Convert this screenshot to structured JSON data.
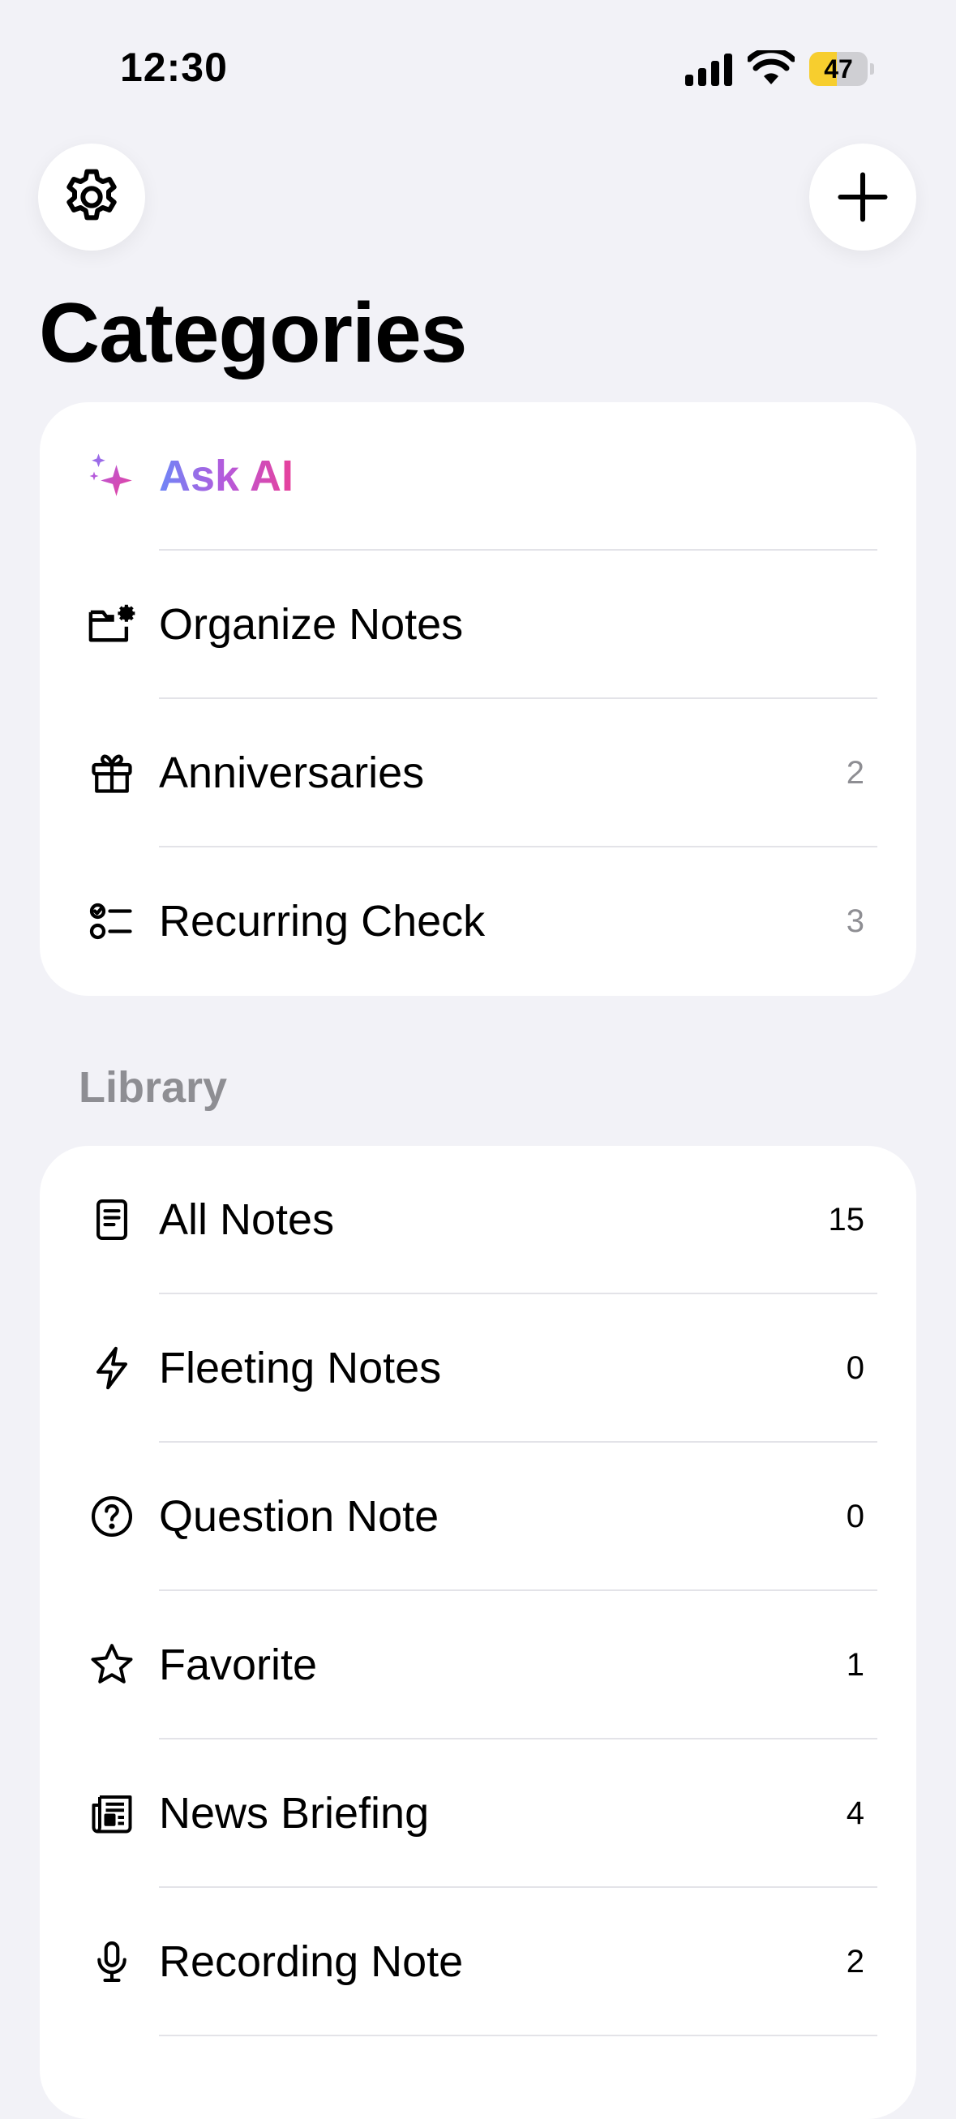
{
  "status_bar": {
    "time": "12:30",
    "battery_percent": "47",
    "battery_level": 0.47,
    "battery_color": "#F7CE2E"
  },
  "header": {
    "settings_icon": "gear-icon",
    "add_icon": "plus-icon",
    "title": "Categories"
  },
  "top_list": {
    "items": [
      {
        "label": "Ask AI",
        "icon": "sparkles-icon",
        "count": ""
      },
      {
        "label": "Organize Notes",
        "icon": "folder-gear-icon",
        "count": ""
      },
      {
        "label": "Anniversaries",
        "icon": "gift-icon",
        "count": "2"
      },
      {
        "label": "Recurring Check",
        "icon": "checklist-icon",
        "count": "3"
      }
    ]
  },
  "library": {
    "header": "Library",
    "items": [
      {
        "label": "All Notes",
        "icon": "document-icon",
        "count": "15"
      },
      {
        "label": "Fleeting Notes",
        "icon": "bolt-icon",
        "count": "0"
      },
      {
        "label": "Question Note",
        "icon": "question-circle-icon",
        "count": "0"
      },
      {
        "label": "Favorite",
        "icon": "star-icon",
        "count": "1"
      },
      {
        "label": "News Briefing",
        "icon": "newspaper-icon",
        "count": "4"
      },
      {
        "label": "Recording Note",
        "icon": "microphone-icon",
        "count": "2"
      }
    ]
  },
  "colors": {
    "background": "#F2F2F7",
    "card": "#FFFFFF",
    "secondary_text": "#8E8E93",
    "ai_gradient": [
      "#6E86F7",
      "#B65ADB",
      "#E8409A"
    ]
  }
}
